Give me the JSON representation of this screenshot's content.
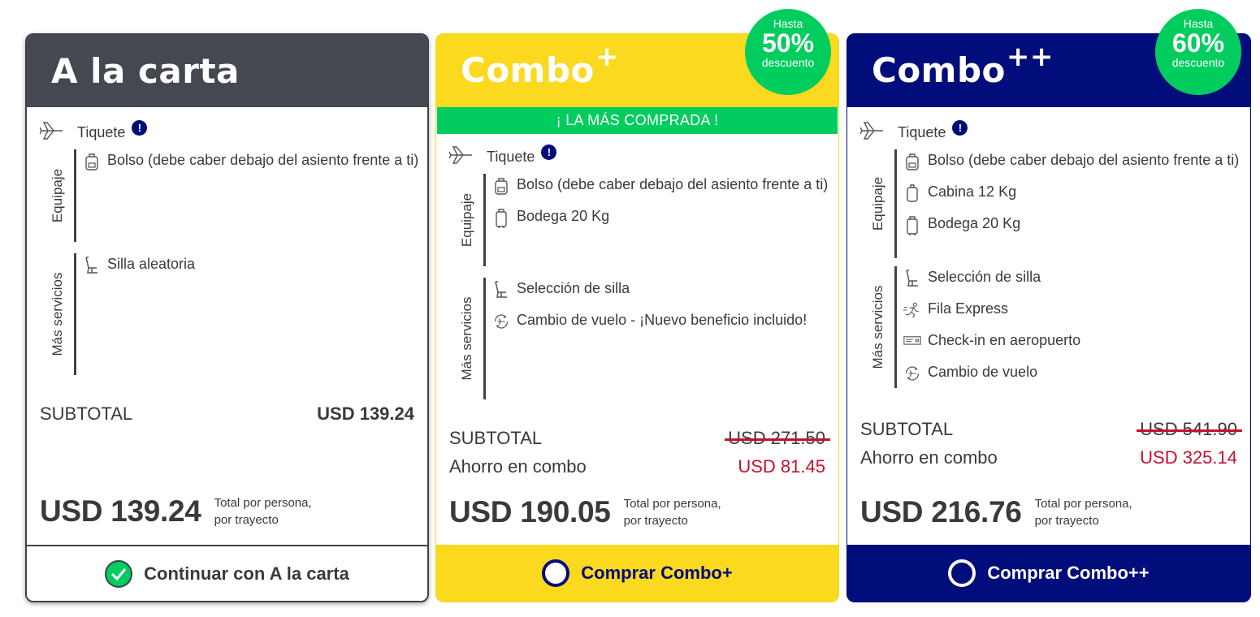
{
  "cards": [
    {
      "title": "A la carta",
      "title_sup": "",
      "tiquete_label": "Tiquete",
      "info_symbol": "!",
      "groups": [
        {
          "label": "Equipaje",
          "items": [
            {
              "icon": "bag-icon",
              "text": "Bolso (debe caber debajo del asiento frente a ti)"
            }
          ]
        },
        {
          "label": "Más servicios",
          "items": [
            {
              "icon": "seat-icon",
              "text": "Silla aleatoria"
            }
          ]
        }
      ],
      "subtotal_label": "SUBTOTAL",
      "subtotal_value": "USD 139.24",
      "total": "USD 139.24",
      "total_note_1": "Total por persona,",
      "total_note_2": "por trayecto",
      "button_label": "Continuar con A la carta",
      "selected": true
    },
    {
      "title": "Combo",
      "title_sup": "+",
      "discount_prefix": "Hasta",
      "discount_value": "50%",
      "discount_suffix": "descuento",
      "ribbon": "¡ LA MÁS COMPRADA !",
      "tiquete_label": "Tiquete",
      "info_symbol": "!",
      "groups": [
        {
          "label": "Equipaje",
          "items": [
            {
              "icon": "bag-icon",
              "text": "Bolso (debe caber debajo del asiento frente a ti)"
            },
            {
              "icon": "suitcase-icon",
              "text": "Bodega 20 Kg"
            }
          ]
        },
        {
          "label": "Más servicios",
          "items": [
            {
              "icon": "seat-icon",
              "text": "Selección de silla"
            },
            {
              "icon": "flight-change-icon",
              "text": "Cambio de vuelo - ¡Nuevo beneficio incluido!"
            }
          ]
        }
      ],
      "subtotal_label": "SUBTOTAL",
      "subtotal_value": "USD 271.50",
      "saving_label": "Ahorro en combo",
      "saving_value": "USD 81.45",
      "total": "USD 190.05",
      "total_note_1": "Total por persona,",
      "total_note_2": "por trayecto",
      "button_label": "Comprar Combo+",
      "selected": false
    },
    {
      "title": "Combo",
      "title_sup": "++",
      "discount_prefix": "Hasta",
      "discount_value": "60%",
      "discount_suffix": "descuento",
      "tiquete_label": "Tiquete",
      "info_symbol": "!",
      "groups": [
        {
          "label": "Equipaje",
          "items": [
            {
              "icon": "bag-icon",
              "text": "Bolso (debe caber debajo del asiento frente a ti)"
            },
            {
              "icon": "cabin-suitcase-icon",
              "text": "Cabina 12 Kg"
            },
            {
              "icon": "suitcase-icon",
              "text": "Bodega 20 Kg"
            }
          ]
        },
        {
          "label": "Más servicios",
          "items": [
            {
              "icon": "seat-icon",
              "text": "Selección de silla"
            },
            {
              "icon": "runner-icon",
              "text": "Fila Express"
            },
            {
              "icon": "boarding-pass-icon",
              "text": "Check-in en aeropuerto"
            },
            {
              "icon": "flight-change-icon",
              "text": "Cambio de vuelo"
            }
          ]
        }
      ],
      "subtotal_label": "SUBTOTAL",
      "subtotal_value": "USD 541.90",
      "saving_label": "Ahorro en combo",
      "saving_value": "USD 325.14",
      "total": "USD 216.76",
      "total_note_1": "Total por persona,",
      "total_note_2": "por trayecto",
      "button_label": "Comprar Combo++",
      "selected": false
    }
  ],
  "colors": {
    "dark_gray": "#434851",
    "yellow": "#fbd91f",
    "navy": "#000d7a",
    "green": "#00cd5e",
    "red": "#c8102e"
  }
}
